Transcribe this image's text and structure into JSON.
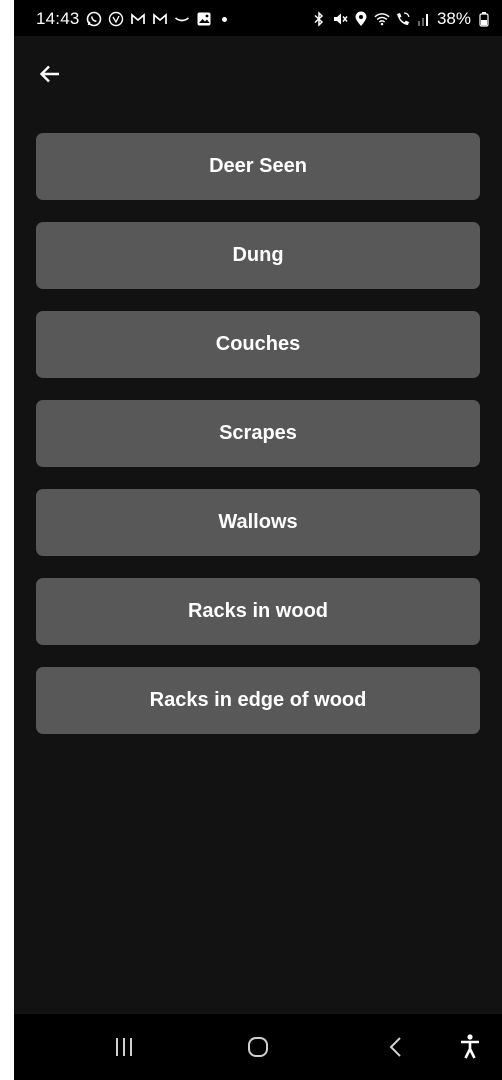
{
  "status_bar": {
    "time": "14:43",
    "battery": "38%",
    "left_icons": [
      "whatsapp-icon",
      "vodafone-icon",
      "gmail-icon",
      "gmail-icon",
      "amazon-icon",
      "gallery-icon",
      "dot-icon"
    ],
    "right_icons": [
      "bluetooth-icon",
      "mute-icon",
      "location-icon",
      "wifi-icon",
      "wifi-calling-icon",
      "signal-icon",
      "battery-icon"
    ]
  },
  "header": {
    "back_icon": "arrow-left-icon"
  },
  "options": [
    {
      "label": "Deer Seen"
    },
    {
      "label": "Dung"
    },
    {
      "label": "Couches"
    },
    {
      "label": "Scrapes"
    },
    {
      "label": "Wallows"
    },
    {
      "label": "Racks in wood"
    },
    {
      "label": "Racks in edge of wood"
    }
  ],
  "nav_bar": {
    "icons": [
      "recent-apps-icon",
      "home-icon",
      "back-icon",
      "accessibility-icon"
    ]
  },
  "colors": {
    "background": "#121212",
    "button": "#585858",
    "text": "#ffffff",
    "bars": "#000000"
  }
}
